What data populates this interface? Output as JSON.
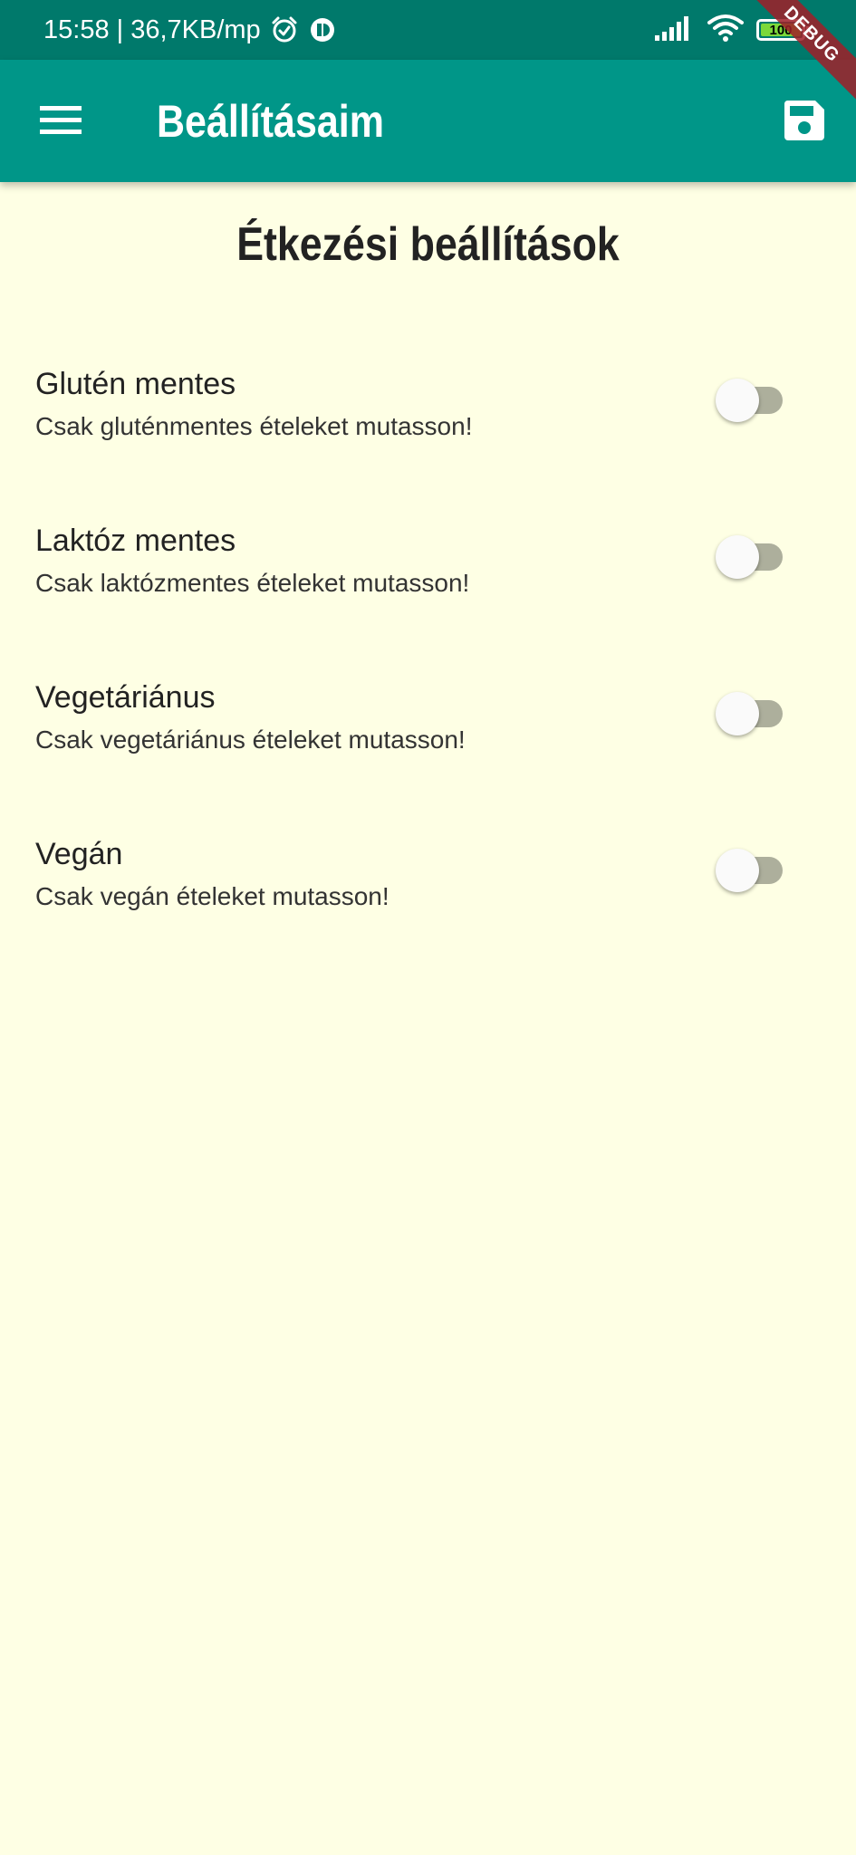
{
  "status_bar": {
    "time_net": "15:58 | 36,7KB/mp",
    "battery_level": "100",
    "battery_fraction": 1.0,
    "icons": [
      "alarm-icon",
      "app-notification-icon",
      "signal-icon",
      "wifi-icon",
      "battery-icon"
    ]
  },
  "debug_banner": "DEBUG",
  "app_bar": {
    "title": "Beállításaim",
    "menu_icon": "hamburger-menu-icon",
    "save_icon": "save-disk-icon",
    "color": "#009688"
  },
  "page": {
    "section_title": "Étkezési beállítások"
  },
  "settings": [
    {
      "title": "Glutén mentes",
      "subtitle": "Csak gluténmentes ételeket mutasson!",
      "enabled": false
    },
    {
      "title": "Laktóz mentes",
      "subtitle": "Csak laktózmentes ételeket mutasson!",
      "enabled": false
    },
    {
      "title": "Vegetáriánus",
      "subtitle": "Csak vegetáriánus ételeket mutasson!",
      "enabled": false
    },
    {
      "title": "Vegán",
      "subtitle": "Csak vegán ételeket mutasson!",
      "enabled": false
    }
  ],
  "colors": {
    "background": "#FEFFE4",
    "status_bar": "#00796B",
    "switch_track_off": "#ADAF9C",
    "switch_thumb_off": "#FAFAFA"
  }
}
